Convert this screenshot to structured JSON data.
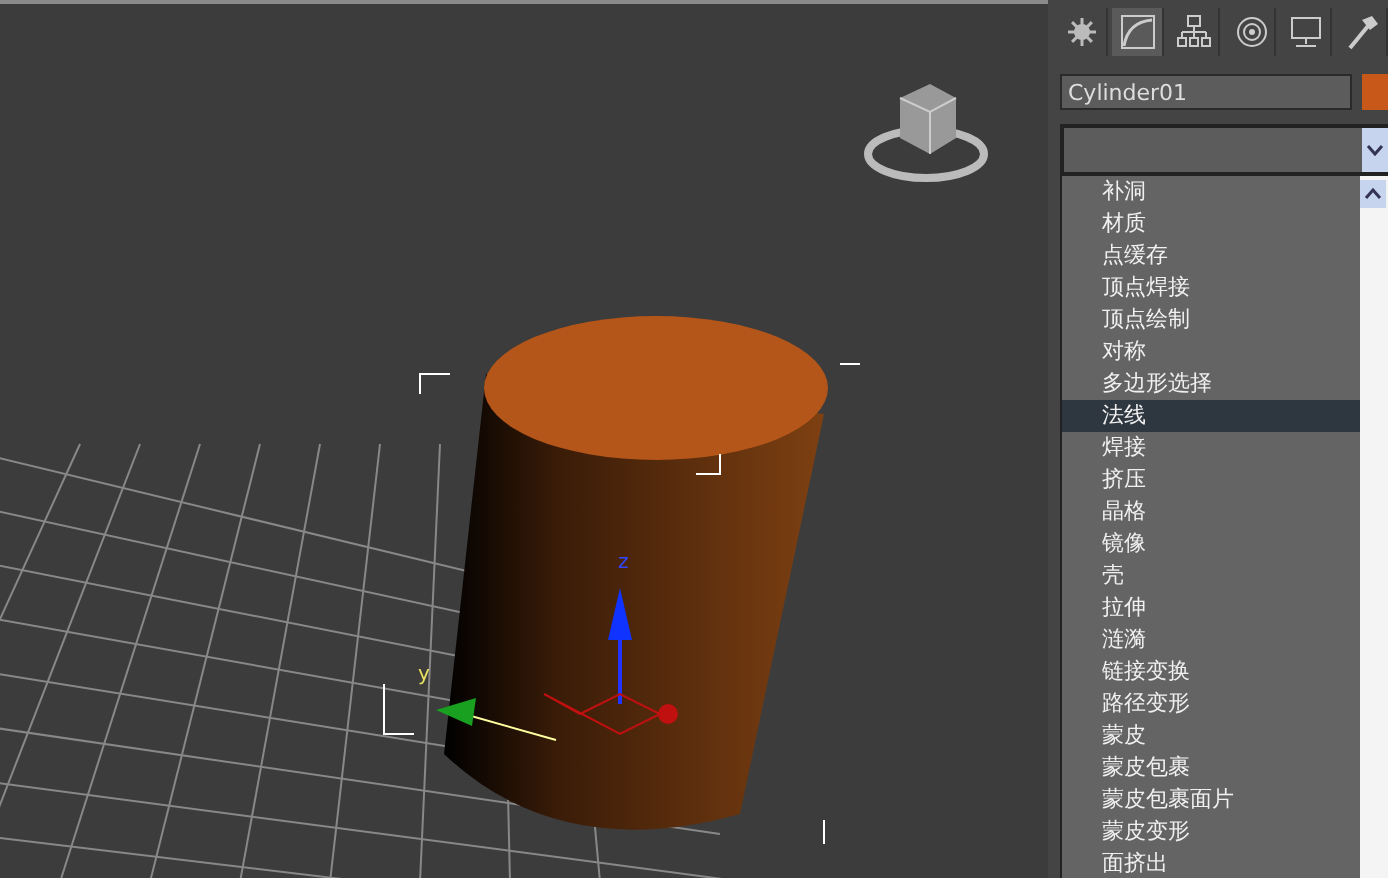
{
  "viewport": {
    "axis_labels": [
      {
        "kind": "y",
        "text": "y"
      },
      {
        "kind": "z",
        "text": "z"
      }
    ]
  },
  "command_panel": {
    "tabs": [
      {
        "kind": "create",
        "selected": false
      },
      {
        "kind": "modify",
        "selected": true
      },
      {
        "kind": "hierarchy",
        "selected": false
      },
      {
        "kind": "motion",
        "selected": false
      },
      {
        "kind": "display",
        "selected": false
      },
      {
        "kind": "utilities",
        "selected": false
      }
    ],
    "object": {
      "name": "Cylinder01",
      "color": "#c8581a"
    },
    "modifier_list": {
      "items": [
        {
          "label": "补洞",
          "selected": false
        },
        {
          "label": "材质",
          "selected": false
        },
        {
          "label": "点缓存",
          "selected": false
        },
        {
          "label": "顶点焊接",
          "selected": false
        },
        {
          "label": "顶点绘制",
          "selected": false
        },
        {
          "label": "对称",
          "selected": false
        },
        {
          "label": "多边形选择",
          "selected": false
        },
        {
          "label": "法线",
          "selected": true
        },
        {
          "label": "焊接",
          "selected": false
        },
        {
          "label": "挤压",
          "selected": false
        },
        {
          "label": "晶格",
          "selected": false
        },
        {
          "label": "镜像",
          "selected": false
        },
        {
          "label": "壳",
          "selected": false
        },
        {
          "label": "拉伸",
          "selected": false
        },
        {
          "label": "涟漪",
          "selected": false
        },
        {
          "label": "链接变换",
          "selected": false
        },
        {
          "label": "路径变形",
          "selected": false
        },
        {
          "label": "蒙皮",
          "selected": false
        },
        {
          "label": "蒙皮包裹",
          "selected": false
        },
        {
          "label": "蒙皮包裹面片",
          "selected": false
        },
        {
          "label": "蒙皮变形",
          "selected": false
        },
        {
          "label": "面挤出",
          "selected": false
        }
      ]
    }
  }
}
